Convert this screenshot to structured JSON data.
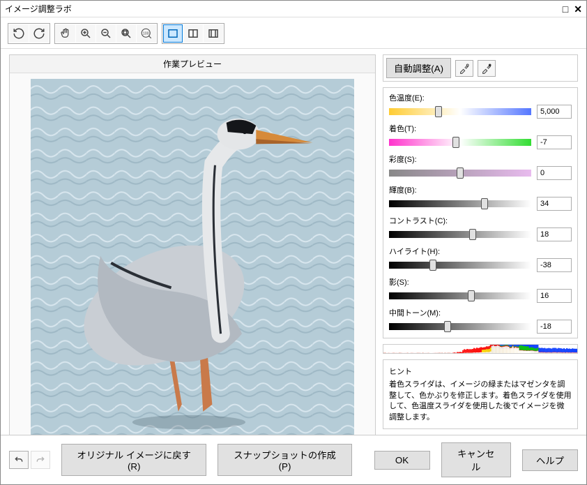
{
  "window": {
    "title": "イメージ調整ラボ"
  },
  "preview": {
    "title": "作業プレビュー"
  },
  "auto": {
    "label": "自動調整(A)"
  },
  "sliders": {
    "color_temp": {
      "label": "色温度(E):",
      "value": "5,000",
      "pos": 35
    },
    "tint": {
      "label": "着色(T):",
      "value": "-7",
      "pos": 47
    },
    "saturation": {
      "label": "彩度(S):",
      "value": "0",
      "pos": 50
    },
    "brightness": {
      "label": "輝度(B):",
      "value": "34",
      "pos": 67
    },
    "contrast": {
      "label": "コントラスト(C):",
      "value": "18",
      "pos": 59
    },
    "highlight": {
      "label": "ハイライト(H):",
      "value": "-38",
      "pos": 31
    },
    "shadow": {
      "label": "影(S):",
      "value": "16",
      "pos": 58
    },
    "midtone": {
      "label": "中間トーン(M):",
      "value": "-18",
      "pos": 41
    }
  },
  "hint": {
    "title": "ヒント",
    "text": "着色スライダは、イメージの緑またはマゼンタを調整して、色かぶりを修正します。着色スライダを使用して、色温度スライダを使用した後でイメージを微調整します。"
  },
  "footer": {
    "revert": "オリジナル イメージに戻す(R)",
    "snapshot": "スナップショットの作成(P)",
    "ok": "OK",
    "cancel": "キャンセル",
    "help": "ヘルプ"
  }
}
